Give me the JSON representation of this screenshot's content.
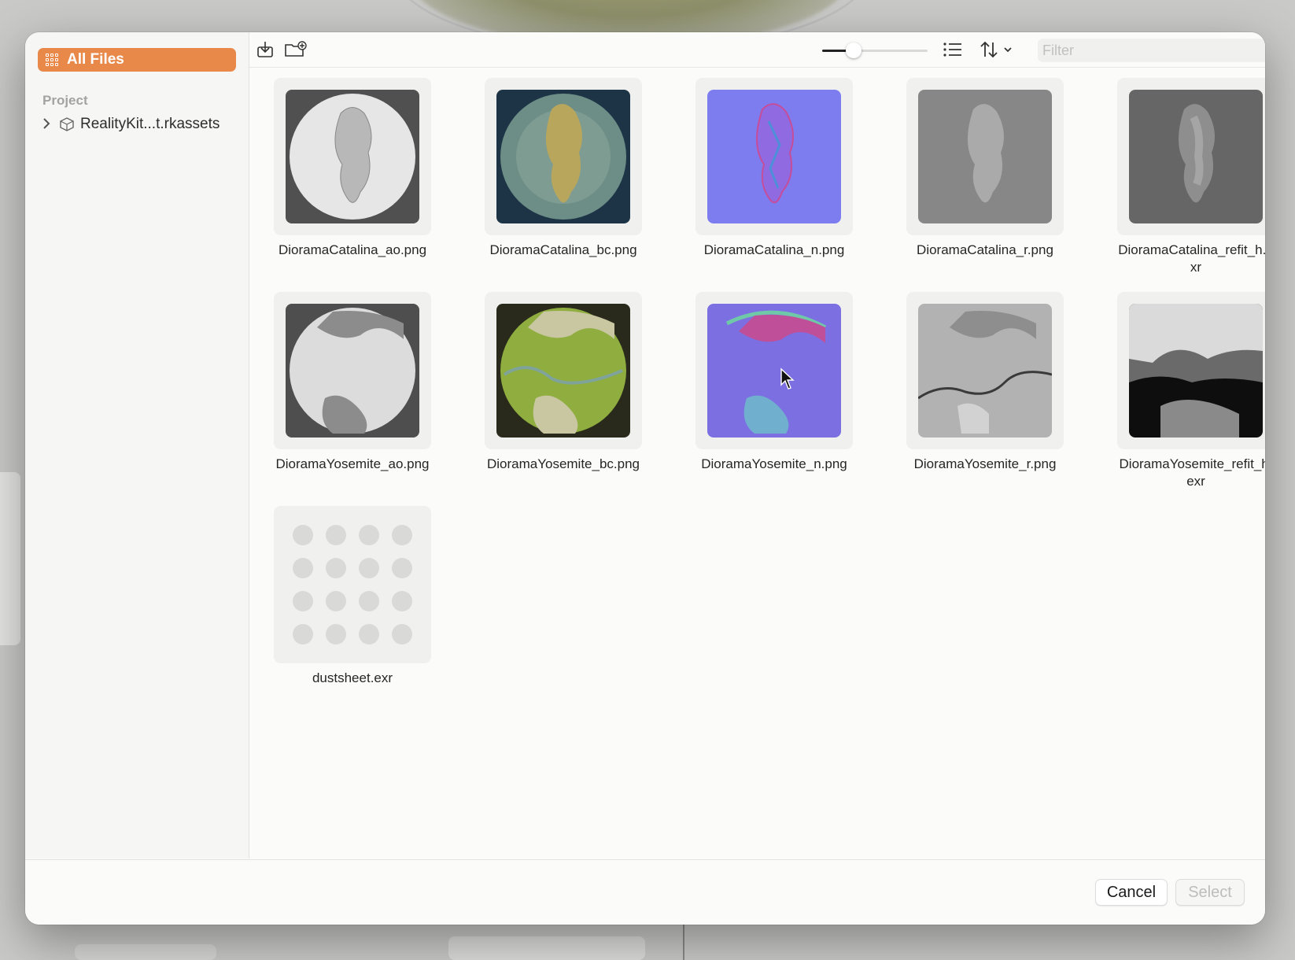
{
  "sidebar": {
    "all_files_label": "All Files",
    "section_label": "Project",
    "project_item_label": "RealityKit...t.rkassets"
  },
  "toolbar": {
    "filter_placeholder": "Filter",
    "thumbnail_size_level": 0.3
  },
  "files": [
    {
      "name": "DioramaCatalina_ao.png",
      "thumb": "ao-catalina"
    },
    {
      "name": "DioramaCatalina_bc.png",
      "thumb": "bc-catalina"
    },
    {
      "name": "DioramaCatalina_n.png",
      "thumb": "n-catalina"
    },
    {
      "name": "DioramaCatalina_r.png",
      "thumb": "r-catalina"
    },
    {
      "name": "DioramaCatalina_refit_h.exr",
      "thumb": "h-catalina"
    },
    {
      "name": "DioramaYosemite_ao.png",
      "thumb": "ao-yosemite"
    },
    {
      "name": "DioramaYosemite_bc.png",
      "thumb": "bc-yosemite"
    },
    {
      "name": "DioramaYosemite_n.png",
      "thumb": "n-yosemite"
    },
    {
      "name": "DioramaYosemite_r.png",
      "thumb": "r-yosemite"
    },
    {
      "name": "DioramaYosemite_refit_h.exr",
      "thumb": "h-yosemite"
    },
    {
      "name": "dustsheet.exr",
      "thumb": "dust"
    }
  ],
  "footer": {
    "cancel_label": "Cancel",
    "select_label": "Select"
  },
  "colors": {
    "accent": "#e8894a"
  }
}
